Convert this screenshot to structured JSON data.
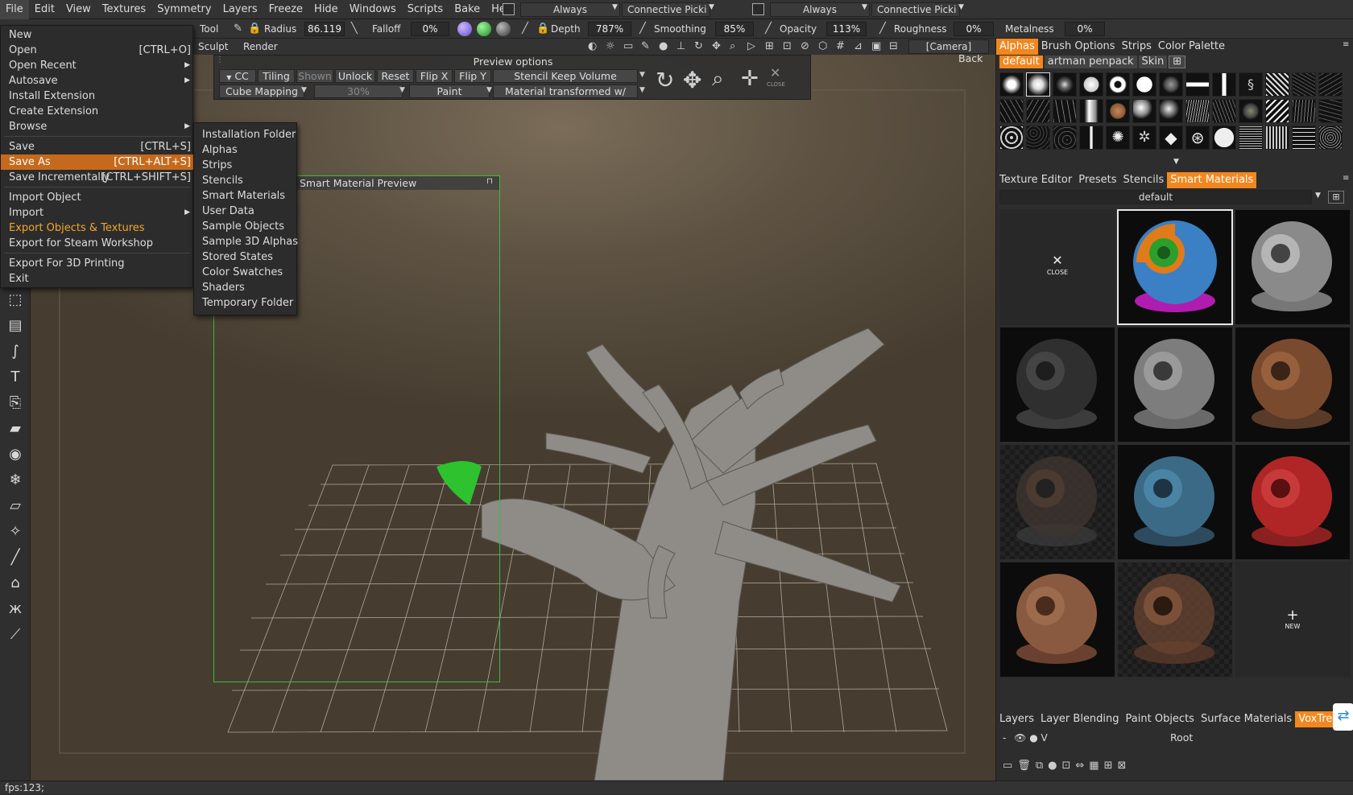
{
  "menubar": {
    "items": [
      "File",
      "Edit",
      "View",
      "Textures",
      "Symmetry",
      "Layers",
      "Freeze",
      "Hide",
      "Windows",
      "Scripts",
      "Bake",
      "Help"
    ],
    "dropdown1": "Always",
    "dropdown2": "Connective Picki",
    "dropdown3": "Always",
    "dropdown4": "Connective Picki"
  },
  "toolbar1": {
    "tool_label": "Tool",
    "radius_label": "Radius",
    "radius_value": "86.119",
    "falloff_label": "Falloff",
    "falloff_value": "0%",
    "depth_label": "Depth",
    "depth_value": "787%",
    "smoothing_label": "Smoothing",
    "smoothing_value": "85%",
    "opacity_label": "Opacity",
    "opacity_value": "113%",
    "roughness_label": "Roughness",
    "roughness_value": "0%",
    "metalness_label": "Metalness",
    "metalness_value": "0%"
  },
  "toolbar2": {
    "sculpt_label": "Sculpt",
    "render_label": "Render",
    "camera": "[Camera]"
  },
  "file_menu": {
    "items": [
      {
        "label": "New",
        "shortcut": ""
      },
      {
        "label": "Open",
        "shortcut": "[CTRL+O]"
      },
      {
        "label": "Open Recent",
        "shortcut": ""
      },
      {
        "label": "Autosave",
        "shortcut": ""
      },
      {
        "label": "Install Extension",
        "shortcut": ""
      },
      {
        "label": "Create Extension",
        "shortcut": ""
      },
      {
        "label": "Browse",
        "shortcut": ""
      },
      {
        "label": "Save",
        "shortcut": "[CTRL+S]"
      },
      {
        "label": "Save As",
        "shortcut": "[CTRL+ALT+S]"
      },
      {
        "label": "Save Incrementally",
        "shortcut": "[CTRL+SHIFT+S]"
      },
      {
        "label": "Import Object",
        "shortcut": ""
      },
      {
        "label": "Import",
        "shortcut": ""
      },
      {
        "label": "Export Objects & Textures",
        "shortcut": ""
      },
      {
        "label": "Export for Steam Workshop",
        "shortcut": ""
      },
      {
        "label": "Export For 3D Printing",
        "shortcut": ""
      },
      {
        "label": "Exit",
        "shortcut": ""
      }
    ]
  },
  "browse_submenu": {
    "items": [
      "Installation Folder",
      "Alphas",
      "Strips",
      "Stencils",
      "Smart Materials",
      "User Data",
      "Sample Objects",
      "Sample 3D Alphas",
      "Stored States",
      "Color Swatches",
      "Shaders",
      "Temporary Folder"
    ]
  },
  "preview_options": {
    "title": "Preview options",
    "cc": "CC",
    "tiling": "Tiling",
    "shown": "Shown",
    "unlock": "Unlock",
    "reset": "Reset",
    "flip_x": "Flip X",
    "flip_y": "Flip Y",
    "stencil_mode": "Stencil Keep Volume",
    "mapping": "Cube Mapping",
    "percent": "30%",
    "paint": "Paint",
    "material_mode": "Material transformed w/",
    "close": "CLOSE"
  },
  "viewport": {
    "back_label": "Back",
    "smart_preview_title": "Smart Material Preview"
  },
  "right_panel": {
    "top_tabs": [
      "Alphas",
      "Brush Options",
      "Strips",
      "Color Palette"
    ],
    "alpha_sets": [
      "default",
      "artman penpack",
      "Skin"
    ],
    "mid_tabs": [
      "Texture Editor",
      "Presets",
      "Stencils",
      "Smart Materials"
    ],
    "smart_set": "default",
    "close_label": "CLOSE",
    "new_label": "NEW",
    "bottom_tabs": [
      "Layers",
      "Layer Blending",
      "Paint Objects",
      "Surface Materials",
      "VoxTree"
    ],
    "voxtree_root": "Root",
    "voxtree_flags": "- V"
  },
  "status": {
    "fps": "fps:123;"
  },
  "colors": {
    "accent": "#f2871f",
    "highlight": "#c56a1c",
    "menu_orange_text": "#f3a72b",
    "preview_frame": "#3dbb3d"
  }
}
